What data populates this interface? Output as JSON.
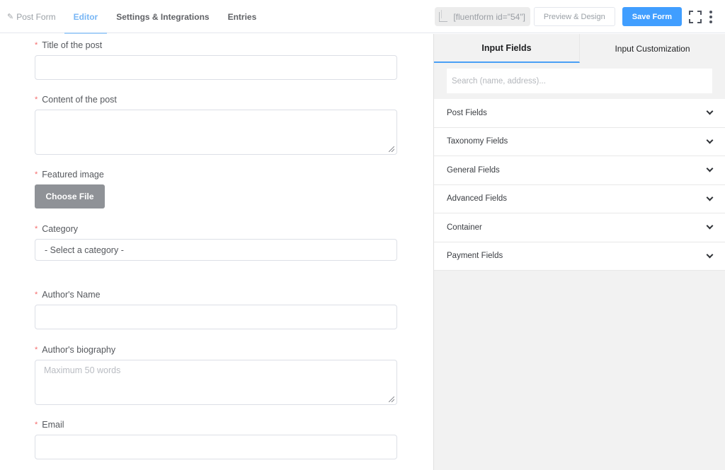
{
  "topbar": {
    "form_name": "Post Form",
    "tabs": [
      {
        "label": "Editor",
        "active": true
      },
      {
        "label": "Settings & Integrations",
        "active": false
      },
      {
        "label": "Entries",
        "active": false
      }
    ],
    "shortcode": "[fluentform id=\"54\"]",
    "preview_label": "Preview & Design",
    "save_label": "Save Form"
  },
  "form": {
    "fields": [
      {
        "label": "Title of the post",
        "required": true,
        "type": "text"
      },
      {
        "label": "Content of the post",
        "required": true,
        "type": "textarea",
        "placeholder": ""
      },
      {
        "label": "Featured image",
        "required": true,
        "type": "file",
        "button_label": "Choose File"
      },
      {
        "label": "Category",
        "required": true,
        "type": "select",
        "value": "- Select a category -"
      },
      {
        "label": "Author's Name",
        "required": true,
        "type": "text"
      },
      {
        "label": "Author's biography",
        "required": true,
        "type": "textarea",
        "placeholder": "Maximum 50 words"
      },
      {
        "label": "Email",
        "required": true,
        "type": "text"
      }
    ],
    "required_marker": "*"
  },
  "sidebar": {
    "tabs": [
      {
        "label": "Input Fields",
        "active": true
      },
      {
        "label": "Input Customization",
        "active": false
      }
    ],
    "search_placeholder": "Search (name, address)...",
    "groups": [
      {
        "label": "Post Fields"
      },
      {
        "label": "Taxonomy Fields"
      },
      {
        "label": "General Fields"
      },
      {
        "label": "Advanced Fields"
      },
      {
        "label": "Container"
      },
      {
        "label": "Payment Fields"
      }
    ]
  },
  "colors": {
    "accent": "#409eff",
    "active_tab": "#78b6f5",
    "required": "#f56c6c",
    "file_button": "#8f9297"
  }
}
